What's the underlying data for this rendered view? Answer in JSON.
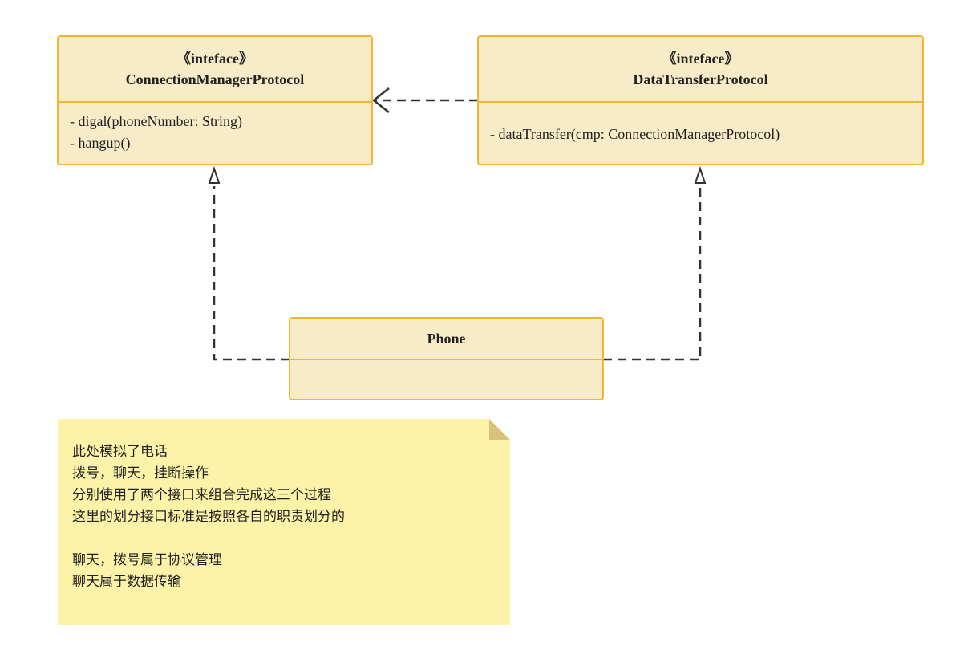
{
  "classes": {
    "connection_manager": {
      "stereotype": "《inteface》",
      "name": "ConnectionManagerProtocol",
      "members": [
        "- digal(phoneNumber: String)",
        "- hangup()"
      ]
    },
    "data_transfer": {
      "stereotype": "《inteface》",
      "name": "DataTransferProtocol",
      "members": [
        "- dataTransfer(cmp: ConnectionManagerProtocol)"
      ]
    },
    "phone": {
      "name": "Phone",
      "members": []
    }
  },
  "note": {
    "lines": [
      "此处模拟了电话",
      "拨号，聊天，挂断操作",
      "分别使用了两个接口来组合完成这三个过程",
      "这里的划分接口标准是按照各自的职责划分的",
      "",
      "聊天，拨号属于协议管理",
      "聊天属于数据传输"
    ]
  },
  "colors": {
    "class_fill": "#f8ecc8",
    "class_border": "#f2b632",
    "note_fill": "#fcf2a8",
    "connector": "#333333"
  }
}
